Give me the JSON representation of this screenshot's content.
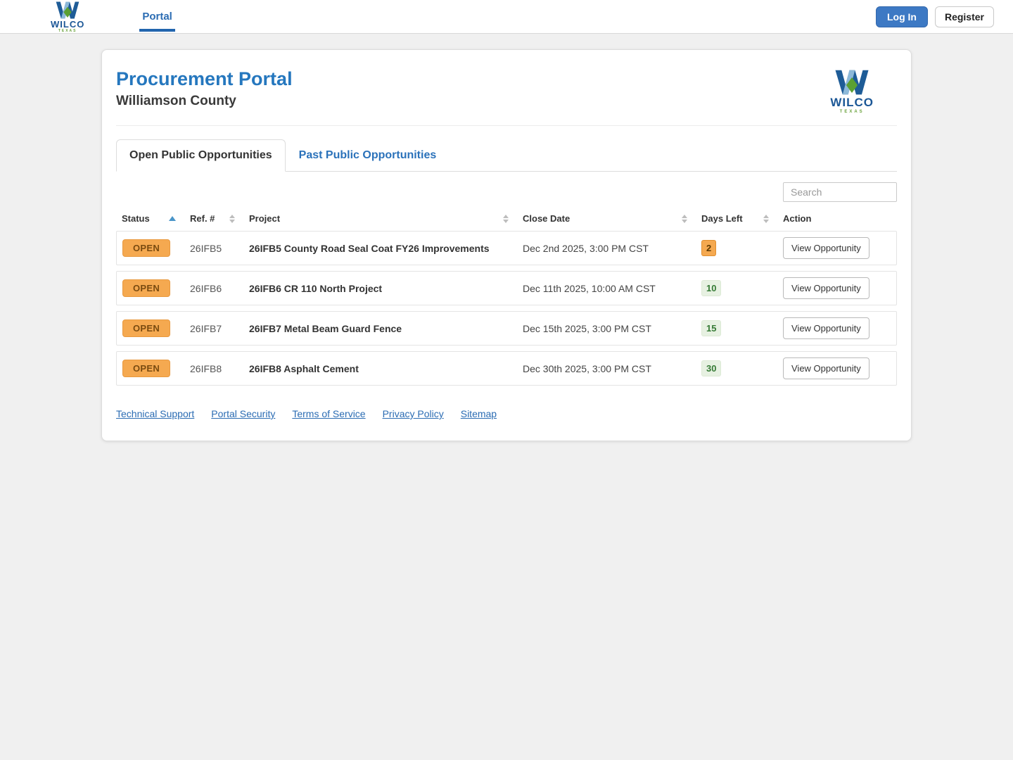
{
  "topbar": {
    "brand": {
      "name": "WILCO",
      "sub": "TEXAS"
    },
    "nav_portal_label": "Portal",
    "login_label": "Log In",
    "register_label": "Register"
  },
  "header": {
    "title": "Procurement Portal",
    "subtitle": "Williamson County"
  },
  "tabs": [
    {
      "label": "Open Public Opportunities",
      "active": true
    },
    {
      "label": "Past Public Opportunities",
      "active": false
    }
  ],
  "search": {
    "placeholder": "Search"
  },
  "table": {
    "columns": [
      {
        "label": "Status",
        "sort": "asc"
      },
      {
        "label": "Ref. #",
        "sort": "both"
      },
      {
        "label": "Project",
        "sort": "both"
      },
      {
        "label": "Close Date",
        "sort": "both"
      },
      {
        "label": "Days Left",
        "sort": "both"
      },
      {
        "label": "Action",
        "sort": "none"
      }
    ],
    "rows": [
      {
        "status": "OPEN",
        "ref": "26IFB5",
        "project": "26IFB5 County Road Seal Coat FY26 Improvements",
        "close_date": "Dec 2nd 2025, 3:00 PM CST",
        "days_left": "2",
        "days_variant": "warning",
        "action": "View Opportunity"
      },
      {
        "status": "OPEN",
        "ref": "26IFB6",
        "project": "26IFB6 CR 110 North Project",
        "close_date": "Dec 11th 2025, 10:00 AM CST",
        "days_left": "10",
        "days_variant": "ok",
        "action": "View Opportunity"
      },
      {
        "status": "OPEN",
        "ref": "26IFB7",
        "project": "26IFB7 Metal Beam Guard Fence",
        "close_date": "Dec 15th 2025, 3:00 PM CST",
        "days_left": "15",
        "days_variant": "ok",
        "action": "View Opportunity"
      },
      {
        "status": "OPEN",
        "ref": "26IFB8",
        "project": "26IFB8 Asphalt Cement",
        "close_date": "Dec 30th 2025, 3:00 PM CST",
        "days_left": "30",
        "days_variant": "ok",
        "action": "View Opportunity"
      }
    ]
  },
  "footer": {
    "links": [
      "Technical Support",
      "Portal Security",
      "Terms of Service",
      "Privacy Policy",
      "Sitemap"
    ]
  },
  "colors": {
    "accent_blue": "#2577be",
    "link_blue": "#2b6cb3",
    "badge_orange_bg": "#f5a950",
    "badge_orange_text": "#7a4b10",
    "badge_green_bg": "#e7f1e2",
    "badge_green_text": "#357a35",
    "logo_dark_blue": "#1e5c97",
    "logo_light_blue": "#8db9d9",
    "logo_green": "#5ba032"
  }
}
